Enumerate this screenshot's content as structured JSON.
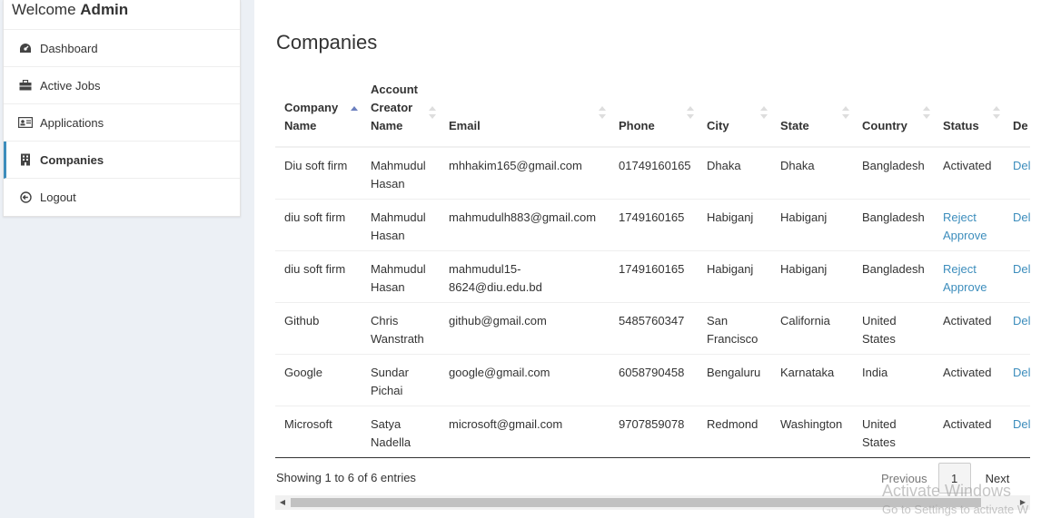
{
  "sidebar": {
    "welcome_prefix": "Welcome",
    "welcome_user": "Admin",
    "items": [
      {
        "label": "Dashboard",
        "icon": "dashboard-icon"
      },
      {
        "label": "Active Jobs",
        "icon": "briefcase-icon"
      },
      {
        "label": "Applications",
        "icon": "id-card-icon"
      },
      {
        "label": "Companies",
        "icon": "building-icon"
      },
      {
        "label": "Logout",
        "icon": "logout-icon"
      }
    ]
  },
  "main": {
    "title": "Companies",
    "columns": [
      "Company Name",
      "Account Creator Name",
      "Email",
      "Phone",
      "City",
      "State",
      "Country",
      "Status",
      "De"
    ],
    "rows": [
      {
        "company": "Diu soft firm",
        "creator": "Mahmudul Hasan",
        "email": "mhhakim165@gmail.com",
        "phone": "01749160165",
        "city": "Dhaka",
        "state": "Dhaka",
        "country": "Bangladesh",
        "status": "Activated",
        "reject": "",
        "approve": "",
        "delete": "Del"
      },
      {
        "company": "diu soft firm",
        "creator": "Mahmudul Hasan",
        "email": "mahmudulh883@gmail.com",
        "phone": "1749160165",
        "city": "Habiganj",
        "state": "Habiganj",
        "country": "Bangladesh",
        "status": "",
        "reject": "Reject",
        "approve": "Approve",
        "delete": "Del"
      },
      {
        "company": "diu soft firm",
        "creator": "Mahmudul Hasan",
        "email": "mahmudul15-8624@diu.edu.bd",
        "phone": "1749160165",
        "city": "Habiganj",
        "state": "Habiganj",
        "country": "Bangladesh",
        "status": "",
        "reject": "Reject",
        "approve": "Approve",
        "delete": "Del"
      },
      {
        "company": "Github",
        "creator": "Chris Wanstrath",
        "email": "github@gmail.com",
        "phone": "5485760347",
        "city": "San Francisco",
        "state": "California",
        "country": "United States",
        "status": "Activated",
        "reject": "",
        "approve": "",
        "delete": "Del"
      },
      {
        "company": "Google",
        "creator": "Sundar Pichai",
        "email": "google@gmail.com",
        "phone": "6058790458",
        "city": "Bengaluru",
        "state": "Karnataka",
        "country": "India",
        "status": "Activated",
        "reject": "",
        "approve": "",
        "delete": "Del"
      },
      {
        "company": "Microsoft",
        "creator": "Satya Nadella",
        "email": "microsoft@gmail.com",
        "phone": "9707859078",
        "city": "Redmond",
        "state": "Washington",
        "country": "United States",
        "status": "Activated",
        "reject": "",
        "approve": "",
        "delete": "Del"
      }
    ],
    "info": "Showing 1 to 6 of 6 entries",
    "pagination": {
      "previous": "Previous",
      "current": "1",
      "next": "Next"
    }
  },
  "watermark": {
    "line1": "Activate Windows",
    "line2": "Go to Settings to activate W"
  },
  "colors": {
    "link": "#3c8dbc",
    "active_border": "#3c8dbc",
    "sort_asc": "#6b7fbf"
  }
}
